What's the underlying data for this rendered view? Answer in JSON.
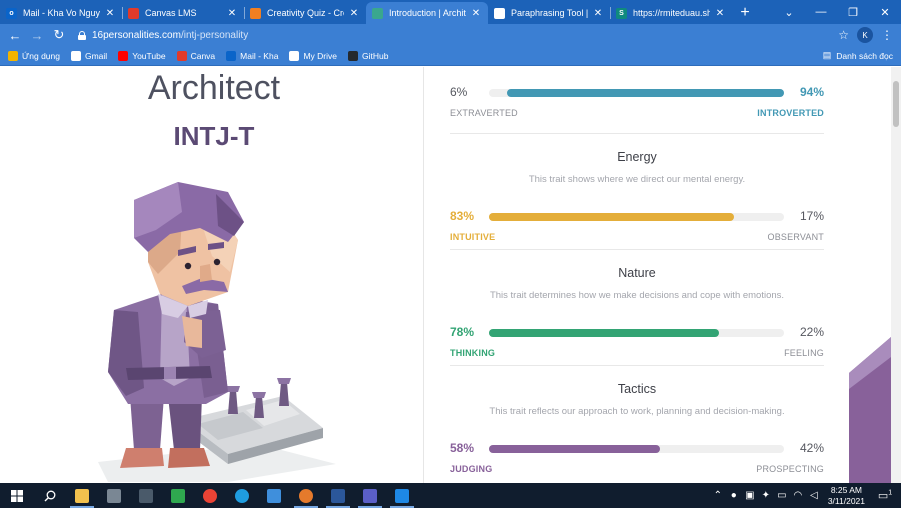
{
  "browser": {
    "tabs": [
      {
        "title": "Mail - Kha Vo Nguyen",
        "icon": "outlook-icon",
        "color": "#0a64c9",
        "glyph": "o"
      },
      {
        "title": "Canvas LMS",
        "icon": "canvas-icon",
        "color": "#e13a2b",
        "glyph": ""
      },
      {
        "title": "Creativity Quiz - Crea",
        "icon": "quiz-icon",
        "color": "#f07f21",
        "glyph": ""
      },
      {
        "title": "Introduction | Archite",
        "icon": "16personalities-icon",
        "color": "#3aa78e",
        "glyph": ""
      },
      {
        "title": "Paraphrasing Tool | Qu",
        "icon": "quillbot-icon",
        "color": "#ffffff",
        "glyph": ""
      },
      {
        "title": "https://rmiteduau.sha",
        "icon": "sharepoint-icon",
        "color": "#0f8a7e",
        "glyph": "S"
      }
    ],
    "active_tab": 3,
    "address": {
      "domain": "16personalities.com",
      "path": "/intj-personality"
    },
    "bookmarks": [
      {
        "label": "Ứng dụng",
        "icon": "apps-grid-icon",
        "color": "#f2b400"
      },
      {
        "label": "Gmail",
        "icon": "gmail-icon",
        "color": "#ffffff"
      },
      {
        "label": "YouTube",
        "icon": "youtube-icon",
        "color": "#ff0000"
      },
      {
        "label": "Canva",
        "icon": "canva-icon",
        "color": "#e13a2b"
      },
      {
        "label": "Mail - Kha",
        "icon": "outlook-icon",
        "color": "#0a64c9"
      },
      {
        "label": "My Drive",
        "icon": "google-icon",
        "color": "#ffffff"
      },
      {
        "label": "GitHub",
        "icon": "github-icon",
        "color": "#24292e"
      }
    ],
    "reading_list": "Danh sách đọc",
    "profile_initial": "K"
  },
  "profile": {
    "type_name": "Architect",
    "type_code": "INTJ-T"
  },
  "traits": [
    {
      "name": "",
      "description": "",
      "left_pct": "6%",
      "right_pct": "94%",
      "left_label": "EXTRAVERTED",
      "right_label": "INTROVERTED",
      "fill_fraction": 0.94,
      "fill_from": "right",
      "color": "#4298b4",
      "left_colored": false
    },
    {
      "name": "Energy",
      "description": "This trait shows where we direct our mental energy.",
      "left_pct": "83%",
      "right_pct": "17%",
      "left_label": "INTUITIVE",
      "right_label": "OBSERVANT",
      "fill_fraction": 0.83,
      "fill_from": "left",
      "color": "#e4ae3a",
      "left_colored": true
    },
    {
      "name": "Nature",
      "description": "This trait determines how we make decisions and cope with emotions.",
      "left_pct": "78%",
      "right_pct": "22%",
      "left_label": "THINKING",
      "right_label": "FEELING",
      "fill_fraction": 0.78,
      "fill_from": "left",
      "color": "#33a474",
      "left_colored": true
    },
    {
      "name": "Tactics",
      "description": "This trait reflects our approach to work, planning and decision-making.",
      "left_pct": "58%",
      "right_pct": "42%",
      "left_label": "JUDGING",
      "right_label": "PROSPECTING",
      "fill_fraction": 0.58,
      "fill_from": "left",
      "color": "#88619a",
      "left_colored": true
    }
  ],
  "taskbar": {
    "apps": [
      {
        "icon": "file-explorer-icon",
        "color": "#f2c14e"
      },
      {
        "icon": "settings-app-icon",
        "color": "#7a8794"
      },
      {
        "icon": "calculator-icon",
        "color": "#4a5a6a"
      },
      {
        "icon": "money-app-icon",
        "color": "#2fa84f"
      },
      {
        "icon": "chrome-icon",
        "color": "#ea4335"
      },
      {
        "icon": "edge-icon",
        "color": "#1f9de0"
      },
      {
        "icon": "photos-app-icon",
        "color": "#3f8fdc"
      },
      {
        "icon": "chrome-profile-icon",
        "color": "#e57a2c"
      },
      {
        "icon": "word-icon",
        "color": "#2b579a"
      },
      {
        "icon": "teams-icon",
        "color": "#5b5fc7"
      },
      {
        "icon": "photos-viewer-icon",
        "color": "#1e88e5"
      }
    ],
    "time": "8:25 AM",
    "date": "3/11/2021",
    "notification_count": "1"
  }
}
